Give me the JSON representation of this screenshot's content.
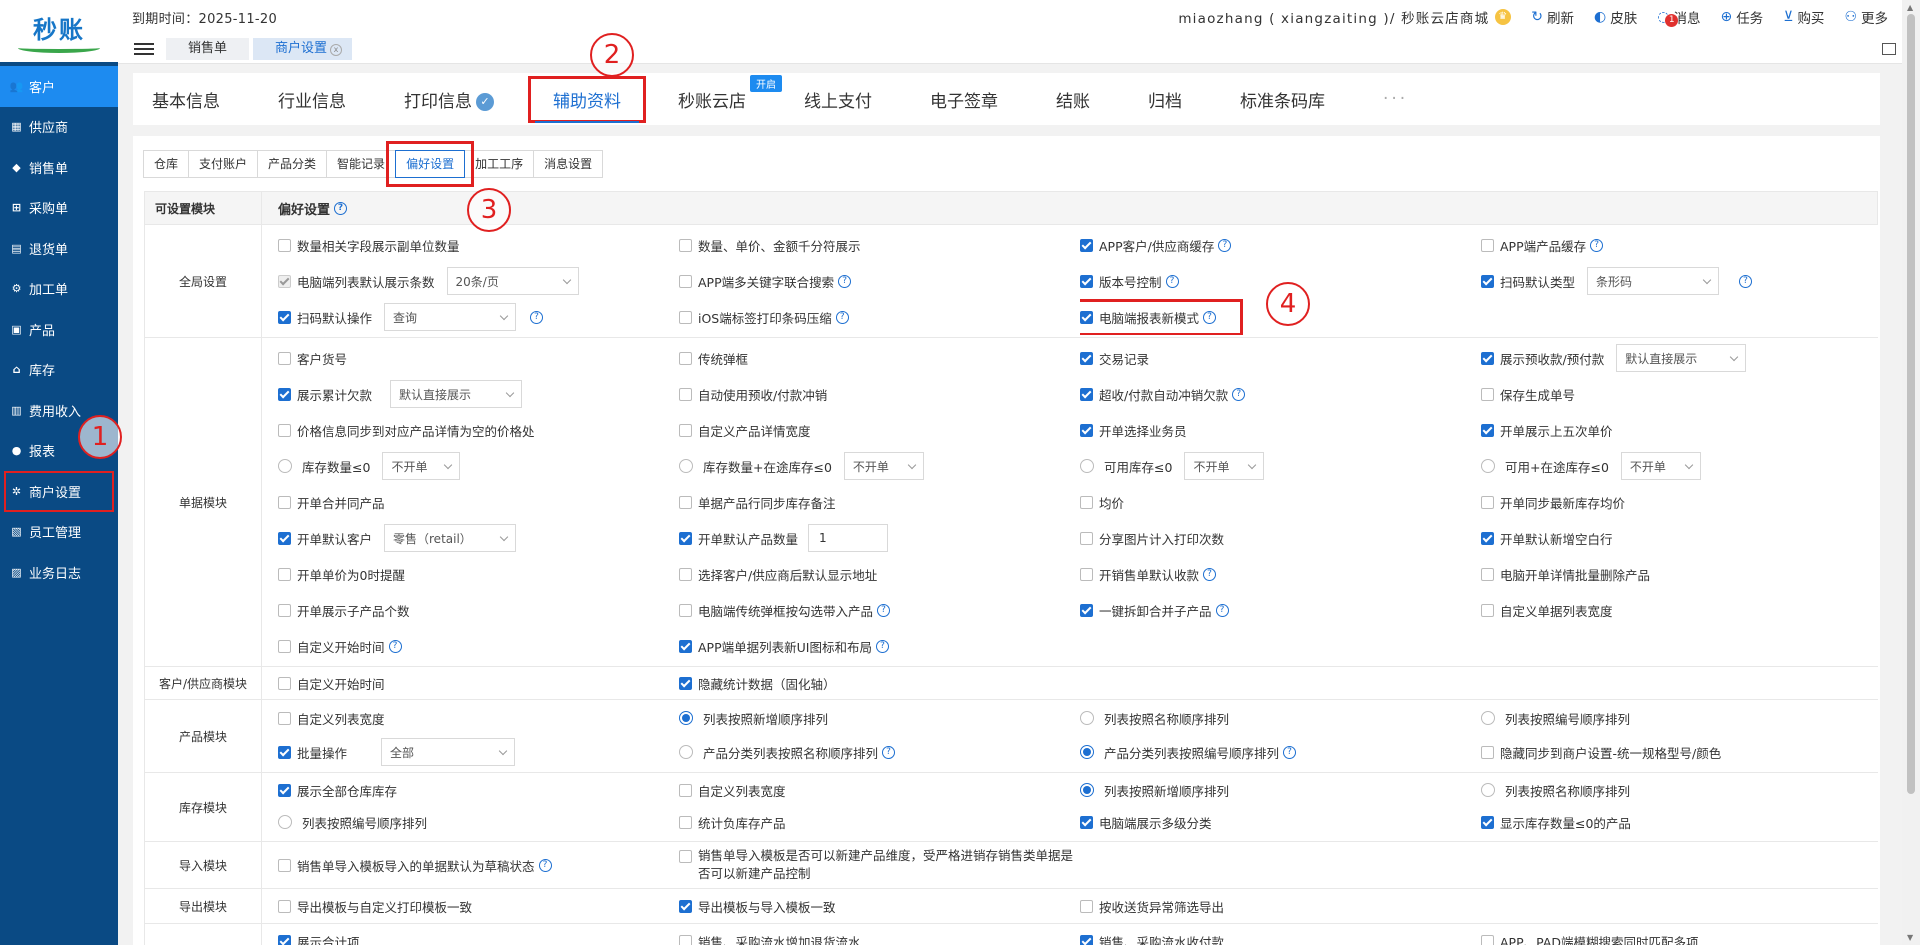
{
  "app": {
    "logo_text": "秒账"
  },
  "sidebar": {
    "items": [
      {
        "label": "客户",
        "icon": "users-icon",
        "active": true
      },
      {
        "label": "供应商",
        "icon": "supplier-icon"
      },
      {
        "label": "销售单",
        "icon": "tag-icon"
      },
      {
        "label": "采购单",
        "icon": "cart-icon"
      },
      {
        "label": "退货单",
        "icon": "return-icon"
      },
      {
        "label": "加工单",
        "icon": "process-icon"
      },
      {
        "label": "产品",
        "icon": "box-icon"
      },
      {
        "label": "库存",
        "icon": "warehouse-icon"
      },
      {
        "label": "费用收入",
        "icon": "expense-icon"
      },
      {
        "label": "报表",
        "icon": "report-icon"
      },
      {
        "label": "商户设置",
        "icon": "gear-icon",
        "highlighted": true
      },
      {
        "label": "员工管理",
        "icon": "staff-icon"
      },
      {
        "label": "业务日志",
        "icon": "log-icon"
      }
    ]
  },
  "topbar": {
    "expiry": "到期时间：2025-11-20",
    "account": "miaozhang ( xiangzaiting )/ 秒账云店商城",
    "refresh": "刷新",
    "skin": "皮肤",
    "messages": "消息",
    "message_count": "1",
    "tasks": "任务",
    "buy": "购买",
    "more": "更多"
  },
  "page_tabs": [
    {
      "label": "销售单"
    },
    {
      "label": "商户设置",
      "active": true,
      "close": "x"
    }
  ],
  "main_tabs": {
    "t0": "基本信息",
    "t1": "行业信息",
    "t2": "打印信息",
    "t2_check": "✓",
    "t3": "辅助资料",
    "t4": "秒账云店",
    "t4_badge": "开启",
    "t5": "线上支付",
    "t6": "电子签章",
    "t7": "结账",
    "t8": "归档",
    "t9": "标准条码库",
    "more": "···"
  },
  "sub_tabs": [
    "仓库",
    "支付账户",
    "产品分类",
    "智能记录",
    "偏好设置",
    "加工工序",
    "消息设置"
  ],
  "table": {
    "header_module": "可设置模块",
    "header_pref": "偏好设置",
    "sections": {
      "global": "全局设置",
      "bill": "单据模块",
      "cust": "客户/供应商模块",
      "product": "产品模块",
      "stock": "库存模块",
      "import": "导入模块",
      "export": "导出模块"
    },
    "opts": {
      "g1": "数量相关字段展示副单位数量",
      "g2": "数量、单价、金额千分符展示",
      "g3": "APP客户/供应商缓存",
      "g4": "APP端产品缓存",
      "g5": "电脑端列表默认展示条数",
      "g5_sel": "20条/页",
      "g6": "APP端多关键字联合搜索",
      "g7": "版本号控制",
      "g8": "扫码默认类型",
      "g8_sel": "条形码",
      "g9": "扫码默认操作",
      "g9_sel": "查询",
      "g10": "iOS端标签打印条码压缩",
      "g11": "电脑端报表新模式",
      "b1": "客户货号",
      "b2": "传统弹框",
      "b3": "交易记录",
      "b4": "展示预收款/预付款",
      "b4_sel": "默认直接展示",
      "b5": "展示累计欠款",
      "b5_sel": "默认直接展示",
      "b6": "自动使用预收/付款冲销",
      "b7": "超收/付款自动冲销欠款",
      "b8": "保存生成单号",
      "b9": "价格信息同步到对应产品详情为空的价格处",
      "b10": "自定义产品详情宽度",
      "b11": "开单选择业务员",
      "b12": "开单展示上五次单价",
      "b13": "库存数量≤0",
      "b13_sel": "不开单",
      "b14": "库存数量+在途库存≤0",
      "b14_sel": "不开单",
      "b15": "可用库存≤0",
      "b15_sel": "不开单",
      "b16": "可用+在途库存≤0",
      "b16_sel": "不开单",
      "b17": "开单合并同产品",
      "b18": "单据产品行同步库存备注",
      "b19": "均价",
      "b20": "开单同步最新库存均价",
      "b21": "开单默认客户",
      "b21_sel": "零售（retail）",
      "b22": "开单默认产品数量",
      "b22_val": "1",
      "b23": "分享图片计入打印次数",
      "b24": "开单默认新增空白行",
      "b25": "开单单价为0时提醒",
      "b26": "选择客户/供应商后默认显示地址",
      "b27": "开销售单默认收款",
      "b28": "电脑开单详情批量删除产品",
      "b29": "开单展示子产品个数",
      "b30": "电脑端传统弹框按勾选带入产品",
      "b31": "一键拆卸合并子产品",
      "b32": "自定义单据列表宽度",
      "b33": "自定义开始时间",
      "b34": "APP端单据列表新UI图标和布局",
      "c1": "自定义开始时间",
      "c2": "隐藏统计数据（固化轴）",
      "p1": "自定义列表宽度",
      "p2": "列表按照新增顺序排列",
      "p3": "列表按照名称顺序排列",
      "p4": "列表按照编号顺序排列",
      "p5": "批量操作",
      "p5_sel": "全部",
      "p6": "产品分类列表按照名称顺序排列",
      "p7": "产品分类列表按照编号顺序排列",
      "p8": "隐藏同步到商户设置-统一规格型号/颜色",
      "s1": "展示全部仓库库存",
      "s2": "自定义列表宽度",
      "s3": "列表按照新增顺序排列",
      "s4": "列表按照名称顺序排列",
      "s5": "列表按照编号顺序排列",
      "s6": "统计负库存产品",
      "s7": "电脑端展示多级分类",
      "s8": "显示库存数量≤0的产品",
      "i1": "销售单导入模板导入的单据默认为草稿状态",
      "i2": "销售单导入模板是否可以新建产品维度，受严格进销存销售类单据是否可以新建产品控制",
      "e1": "导出模板与自定义打印模板一致",
      "e2": "导出模板与导入模板一致",
      "e3": "按收送货异常筛选导出",
      "x1": "展示合计项",
      "x2": "销售、采购流水增加退货流水",
      "x3": "销售、采购流水收付款",
      "x4": "APP、PAD端模糊搜索同时匹配多项"
    }
  },
  "annotations": {
    "n1": "1",
    "n2": "2",
    "n3": "3",
    "n4": "4"
  },
  "colors": {
    "sidebar_bg": "#0a4a84",
    "accent": "#1d6fd1",
    "highlight": "#e02020",
    "active_nav": "#1d8bf0"
  }
}
